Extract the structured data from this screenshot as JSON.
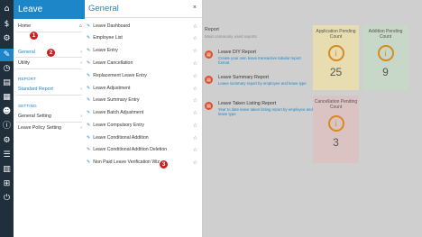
{
  "rail_icons": [
    "home-icon",
    "dollar-icon",
    "gear-icon",
    "edit-icon",
    "clock-icon",
    "file-icon",
    "report-icon",
    "people-icon",
    "info-icon",
    "settings-icon",
    "notes-icon",
    "table-icon",
    "hierarchy-icon",
    "settings-icon",
    "power-icon"
  ],
  "sidebar": {
    "title": "Leave",
    "home": "Home",
    "general": "General",
    "utility": "Utility",
    "report_section": "REPORT",
    "standard_report": "Standard Report",
    "setting_section": "SETTING",
    "general_setting": "General Setting",
    "leave_policy_setting": "Leave Policy Setting"
  },
  "menu": {
    "title": "General",
    "close": "×",
    "items": [
      "Leave Dashboard",
      "Employee List",
      "Leave Entry",
      "Leave Cancellation",
      "Replacement Leave Entry",
      "Leave Adjustment",
      "Leave Summary Entry",
      "Leave Batch Adjustment",
      "Leave Compulsory Entry",
      "Leave Conditional Addition",
      "Leave Conditional Addition Deletion",
      "Non Paid Leave Verification Wizard"
    ]
  },
  "callouts": [
    "1",
    "2",
    "3"
  ],
  "report": {
    "title": "Report",
    "subtitle": "Most commonly used reports",
    "items": [
      {
        "title": "Leave DIY Report",
        "desc": "Create your own leave transactive tabular report format"
      },
      {
        "title": "Leave Summary Report",
        "desc": "Leave summary report by employee and leave type"
      },
      {
        "title": "Leave Taken Listing Report",
        "desc": "Year to date leave taken listing report by employee and leave type"
      }
    ]
  },
  "cards": [
    {
      "title": "Application Pending Count",
      "value": "25",
      "color": "#e8ddb0"
    },
    {
      "title": "Addition Pending Count",
      "value": "9",
      "color": "#c8d8c8"
    },
    {
      "title": "Cancellation Pending Count",
      "value": "3",
      "color": "#dcc3c3"
    }
  ]
}
